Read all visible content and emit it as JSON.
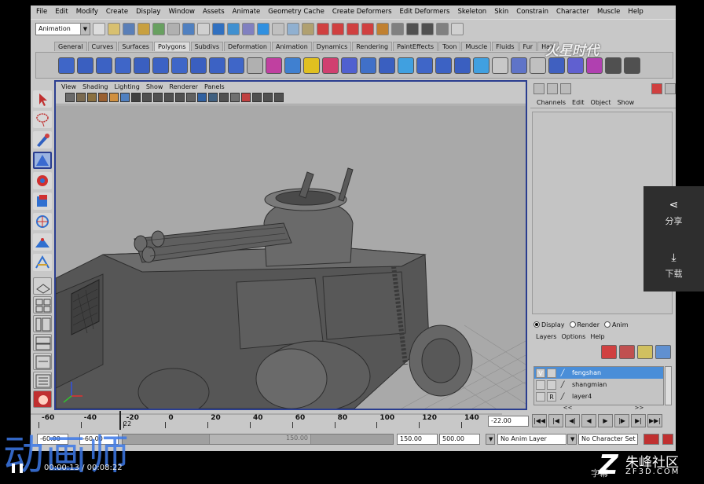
{
  "menubar": [
    "File",
    "Edit",
    "Modify",
    "Create",
    "Display",
    "Window",
    "Assets",
    "Animate",
    "Geometry Cache",
    "Create Deformers",
    "Edit Deformers",
    "Skeleton",
    "Skin",
    "Constrain",
    "Character",
    "Muscle",
    "Help"
  ],
  "status_line": {
    "mode": "Animation"
  },
  "shelf_tabs": [
    "General",
    "Curves",
    "Surfaces",
    "Polygons",
    "Subdivs",
    "Deformation",
    "Animation",
    "Dynamics",
    "Rendering",
    "PaintEffects",
    "Toon",
    "Muscle",
    "Fluids",
    "Fur",
    "Hair"
  ],
  "shelf_active_tab": "Polygons",
  "panel_menu": [
    "View",
    "Shading",
    "Lighting",
    "Show",
    "Renderer",
    "Panels"
  ],
  "channel_box": {
    "menu": [
      "Channels",
      "Edit",
      "Object",
      "Show"
    ]
  },
  "layer_editor": {
    "modes": [
      "Display",
      "Render",
      "Anim"
    ],
    "active_mode": "Display",
    "menu": [
      "Layers",
      "Options",
      "Help"
    ],
    "layers": [
      {
        "v": "V",
        "p": "",
        "name": "fengshan",
        "selected": true
      },
      {
        "v": "",
        "p": "",
        "name": "shangmian",
        "selected": false
      },
      {
        "v": "",
        "p": "R",
        "name": "layer4",
        "selected": false
      }
    ]
  },
  "time_slider": {
    "ticks": [
      "-60",
      "-40",
      "-20",
      "0",
      "20",
      "40",
      "60",
      "80",
      "100",
      "120",
      "140"
    ],
    "current_marker": "22",
    "current_frame": "-22.00"
  },
  "range_slider": {
    "start": "-60.00",
    "range_start": "-60.00",
    "range_end": "150.00",
    "end_a": "150.00",
    "end_b": "500.00",
    "anim_layer": "No Anim Layer",
    "char_set": "No Character Set",
    "knob_label": "150.00"
  },
  "share_panel": {
    "share_label": "分享",
    "download_label": "下载",
    "share_icon": "share-icon",
    "download_icon": "download-icon"
  },
  "overlay": {
    "title": "动画师",
    "timecode": "00:00:13 / 00:08:22",
    "site_name": "朱峰社区",
    "site_url": "ZF3D.COM",
    "subtitle_label": "字幕",
    "top_watermark": "火星时代"
  },
  "colors": {
    "selected_layer": "#4a8ed8",
    "panel_border": "#2a3d8f",
    "viewport_bg": "#a9a9a9",
    "title_blue": "#3c78e6"
  }
}
